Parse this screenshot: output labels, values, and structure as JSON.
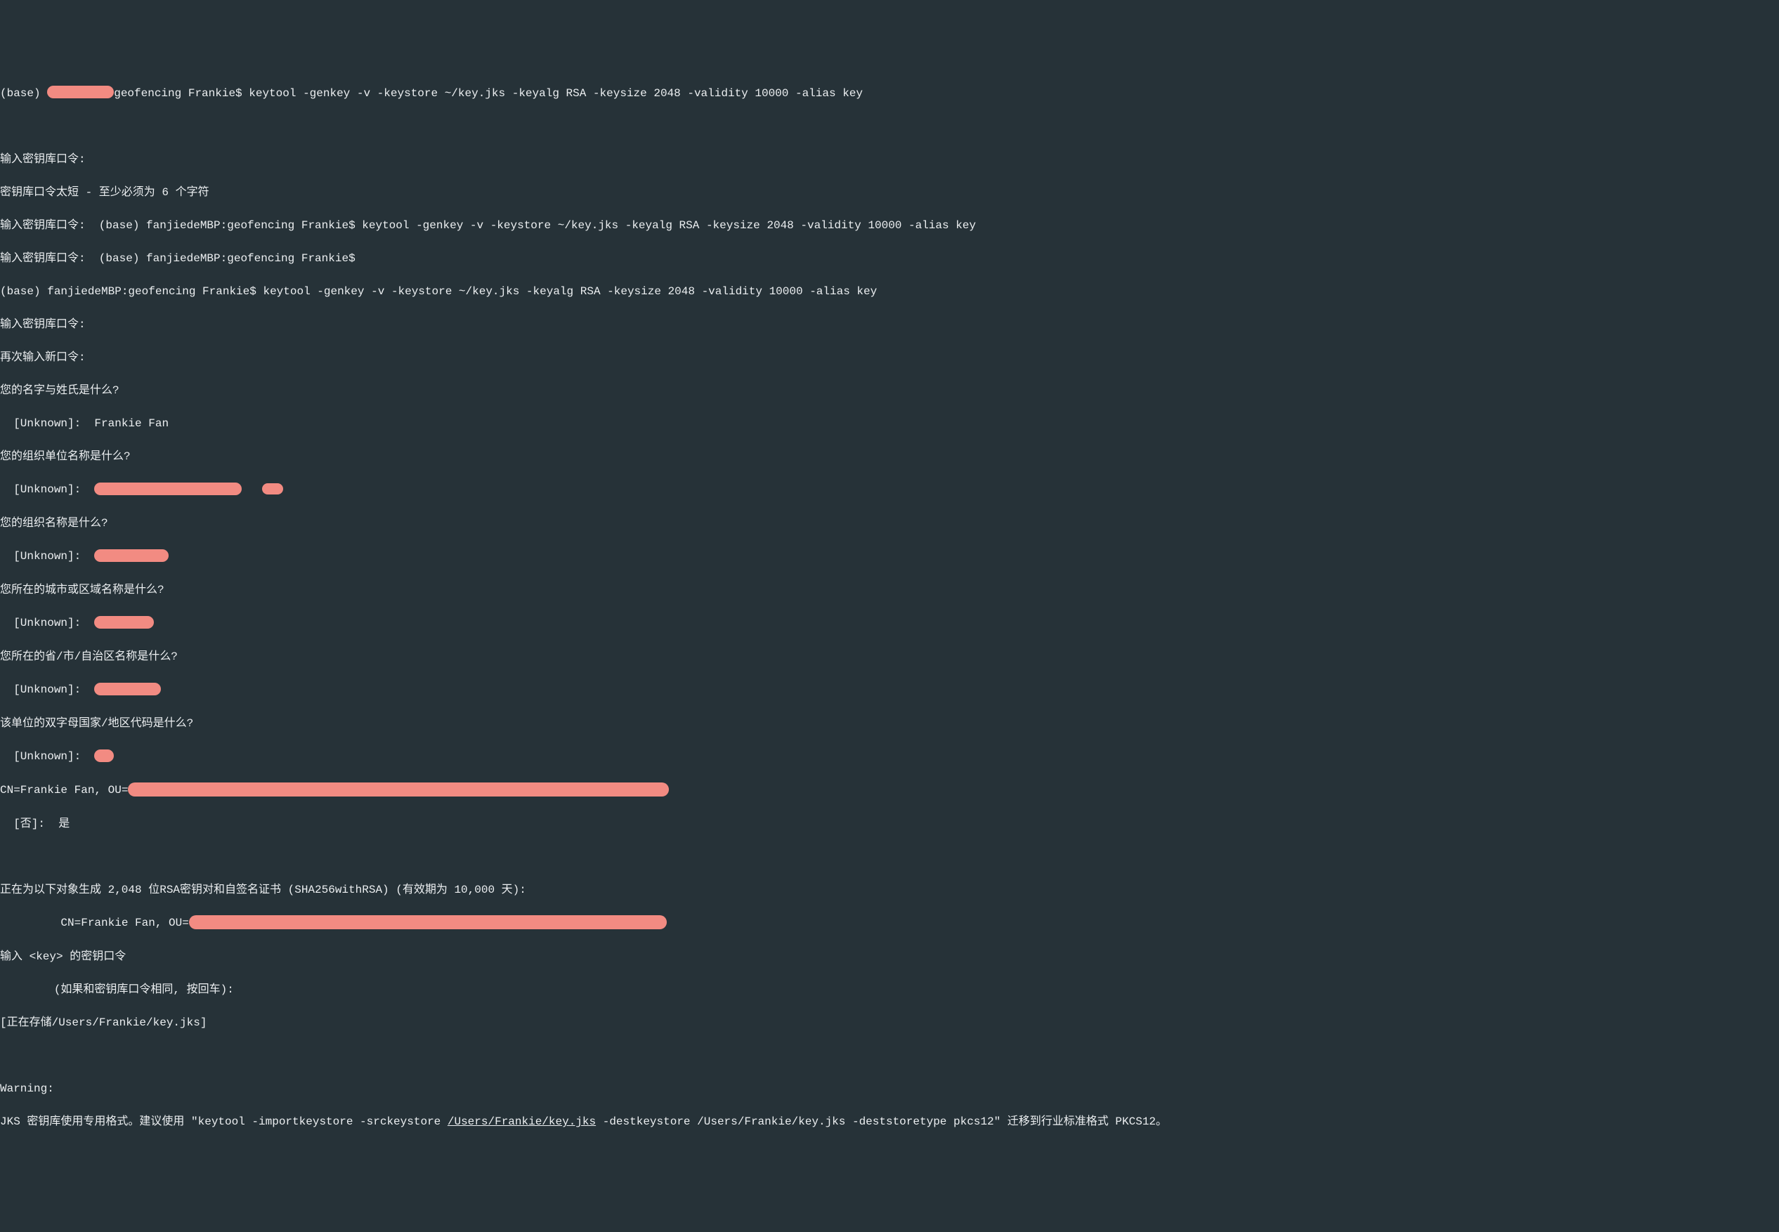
{
  "lines": {
    "l1_pre": "(base) ",
    "l1_post": "geofencing Frankie$ keytool -genkey -v -keystore ~/key.jks -keyalg RSA -keysize 2048 -validity 10000 -alias key",
    "l2": "",
    "l3": "输入密钥库口令:  ",
    "l4": "密钥库口令太短 - 至少必须为 6 个字符",
    "l5": "输入密钥库口令:  (base) fanjiedeMBP:geofencing Frankie$ keytool -genkey -v -keystore ~/key.jks -keyalg RSA -keysize 2048 -validity 10000 -alias key",
    "l6": "输入密钥库口令:  (base) fanjiedeMBP:geofencing Frankie$ ",
    "l7": "(base) fanjiedeMBP:geofencing Frankie$ keytool -genkey -v -keystore ~/key.jks -keyalg RSA -keysize 2048 -validity 10000 -alias key",
    "l8": "输入密钥库口令:  ",
    "l9": "再次输入新口令: ",
    "l10": "您的名字与姓氏是什么?",
    "l11": "  [Unknown]:  Frankie Fan",
    "l12": "您的组织单位名称是什么?",
    "l13_pre": "  [Unknown]:  ",
    "l14": "您的组织名称是什么?",
    "l15_pre": "  [Unknown]:  ",
    "l16": "您所在的城市或区域名称是什么?",
    "l17_pre": "  [Unknown]:  ",
    "l18": "您所在的省/市/自治区名称是什么?",
    "l19_pre": "  [Unknown]:  ",
    "l20": "该单位的双字母国家/地区代码是什么?",
    "l21_pre": "  [Unknown]:  ",
    "l22_pre": "CN=Frankie Fan, OU=",
    "l23": "  [否]:  是",
    "l24": "",
    "l25": "正在为以下对象生成 2,048 位RSA密钥对和自签名证书 (SHA256withRSA) (有效期为 10,000 天):",
    "l26_pre": "\t CN=Frankie Fan, OU=",
    "l27": "输入 <key> 的密钥口令",
    "l28": "\t(如果和密钥库口令相同, 按回车):  ",
    "l29": "[正在存储/Users/Frankie/key.jks]",
    "l30": "",
    "l31": "Warning:",
    "l32_a": "JKS 密钥库使用专用格式。建议使用 \"keytool -importkeystore -srckeystore ",
    "l32_b": "/Users/Frankie/key.jks",
    "l32_c": " -destkeystore /Users/Frankie/key.jks -deststoretype pkcs12\" 迁移到行业标准格式 PKCS12。"
  }
}
